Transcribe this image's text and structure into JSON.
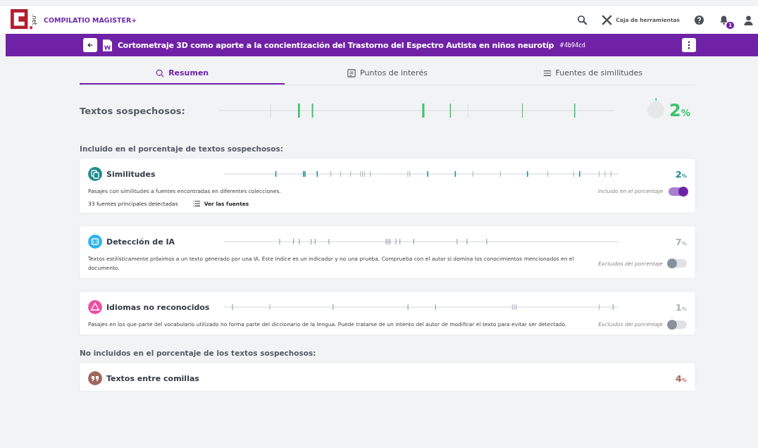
{
  "app": {
    "brand": "COMPILATIO MAGISTER+",
    "logo_suffix": ".net",
    "toolbox": "Caja de herramientas",
    "notifications": "1"
  },
  "document": {
    "title": "Cortometraje 3D como aporte a la concientización del Trastorno del Espectro Autista en niños neurotíp",
    "id": "#4b94cd"
  },
  "tabs": [
    {
      "label": "Resumen",
      "selected": true
    },
    {
      "label": "Puntos de interés",
      "selected": false
    },
    {
      "label": "Fuentes de similitudes",
      "selected": false
    }
  ],
  "summary": {
    "label": "Textos sospechosos:",
    "value": "2",
    "unit": "%"
  },
  "sections": [
    {
      "heading": "Incluido en el porcentaje de textos sospechosos:",
      "cards": [
        {
          "title": "Similitudes",
          "color": "#1d8a8c",
          "value": "2",
          "unit": "%",
          "description": "Pasajes con similitudes a fuentes encontradas en diferentes colecciones.",
          "toggle_label": "incluido en el porcentaje",
          "on": true,
          "sources_count": "33 fuentes principales detectadas",
          "sources_link": "Ver las fuentes"
        },
        {
          "title": "Detección de IA",
          "color": "#2fb4ec",
          "value": "7",
          "unit": "%",
          "description": "Textos estilísticamente próximos a un texto generado por una IA. Este índice es un indicador y no una prueba. Comprueba con el autor si domina los conocimientos mencionados en el documento.",
          "toggle_label": "Excluidos del porcentaje",
          "on": false
        },
        {
          "title": "Idiomas no reconocidos",
          "color": "#ea4fa3",
          "value": "1",
          "unit": "%",
          "description": "Pasajes en los que parte del vocabulario utilizado no forma parte del diccionario de la lengua. Puede tratarse de un intento del autor de modificar el texto para evitar ser detectado.",
          "toggle_label": "Excluidos del porcentaje",
          "on": false
        }
      ]
    },
    {
      "heading": "No incluidos en el porcentaje de los textos sospechosos:",
      "cards": [
        {
          "title": "Textos entre comillas",
          "color": "#a0675d",
          "value": "4",
          "unit": "%"
        }
      ]
    }
  ]
}
